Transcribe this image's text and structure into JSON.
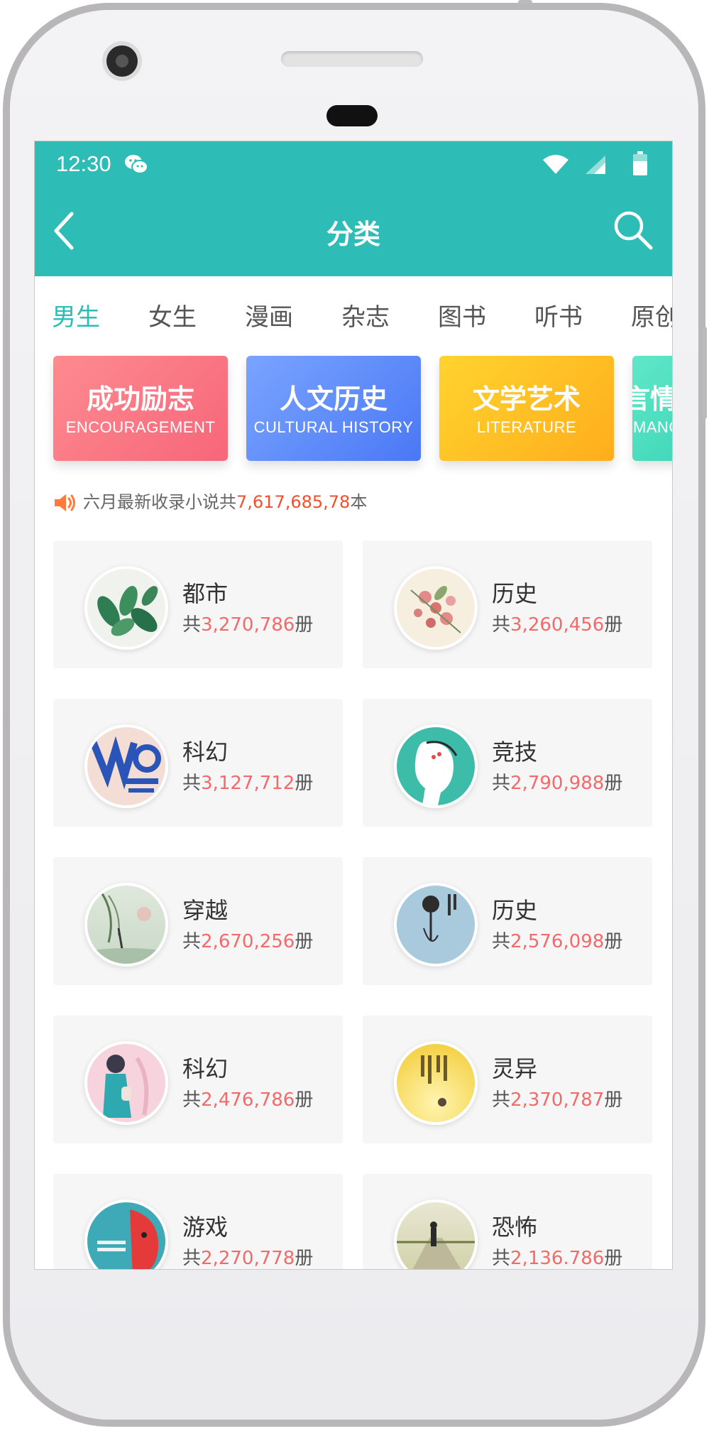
{
  "status": {
    "time": "12:30"
  },
  "header": {
    "title": "分类"
  },
  "tabs": [
    {
      "label": "男生",
      "active": true
    },
    {
      "label": "女生",
      "active": false
    },
    {
      "label": "漫画",
      "active": false
    },
    {
      "label": "杂志",
      "active": false
    },
    {
      "label": "图书",
      "active": false
    },
    {
      "label": "听书",
      "active": false
    },
    {
      "label": "原创",
      "active": false
    }
  ],
  "banners": [
    {
      "title": "成功励志",
      "subtitle": "ENCOURAGEMENT",
      "colors": [
        "#fc7f87",
        "#f96c7a"
      ]
    },
    {
      "title": "人文历史",
      "subtitle": "CULTURAL HISTORY",
      "colors": [
        "#6f9bff",
        "#4f7cf6"
      ]
    },
    {
      "title": "文学艺术",
      "subtitle": "LITERATURE",
      "colors": [
        "#ffd02a",
        "#ffb21e"
      ]
    },
    {
      "title": "言情",
      "subtitle": "ROMANCE",
      "colors": [
        "#58e5c5",
        "#2dcbb0"
      ]
    }
  ],
  "notice": {
    "prefix": "六月最新收录小说共",
    "count": "7,617,685,78",
    "suffix": "本"
  },
  "categories": [
    {
      "name": "都市",
      "pre": "共",
      "count": "3,270,786",
      "post": "册",
      "icon": "green-leaves-cover"
    },
    {
      "name": "历史",
      "pre": "共",
      "count": "3,260,456",
      "post": "册",
      "icon": "pink-flowers-cover"
    },
    {
      "name": "科幻",
      "pre": "共",
      "count": "3,127,712",
      "post": "册",
      "icon": "art-of-money-cover"
    },
    {
      "name": "竞技",
      "pre": "共",
      "count": "2,790,988",
      "post": "册",
      "icon": "girl-profile-cover"
    },
    {
      "name": "穿越",
      "pre": "共",
      "count": "2,670,256",
      "post": "册",
      "icon": "willow-landscape-cover"
    },
    {
      "name": "历史",
      "pre": "共",
      "count": "2,576,098",
      "post": "册",
      "icon": "rose-figure-cover"
    },
    {
      "name": "科幻",
      "pre": "共",
      "count": "2,476,786",
      "post": "册",
      "icon": "girl-in-pink-cover"
    },
    {
      "name": "灵异",
      "pre": "共",
      "count": "2,370,787",
      "post": "册",
      "icon": "yellow-light-cover"
    },
    {
      "name": "游戏",
      "pre": "共",
      "count": "2,270,778",
      "post": "册",
      "icon": "red-face-cover"
    },
    {
      "name": "恐怖",
      "pre": "共",
      "count": "2,136.786",
      "post": "册",
      "icon": "road-walker-cover"
    }
  ],
  "colors": {
    "accent": "#2dbdb6",
    "count": "#f26a6a",
    "notice": "#f0502d"
  }
}
